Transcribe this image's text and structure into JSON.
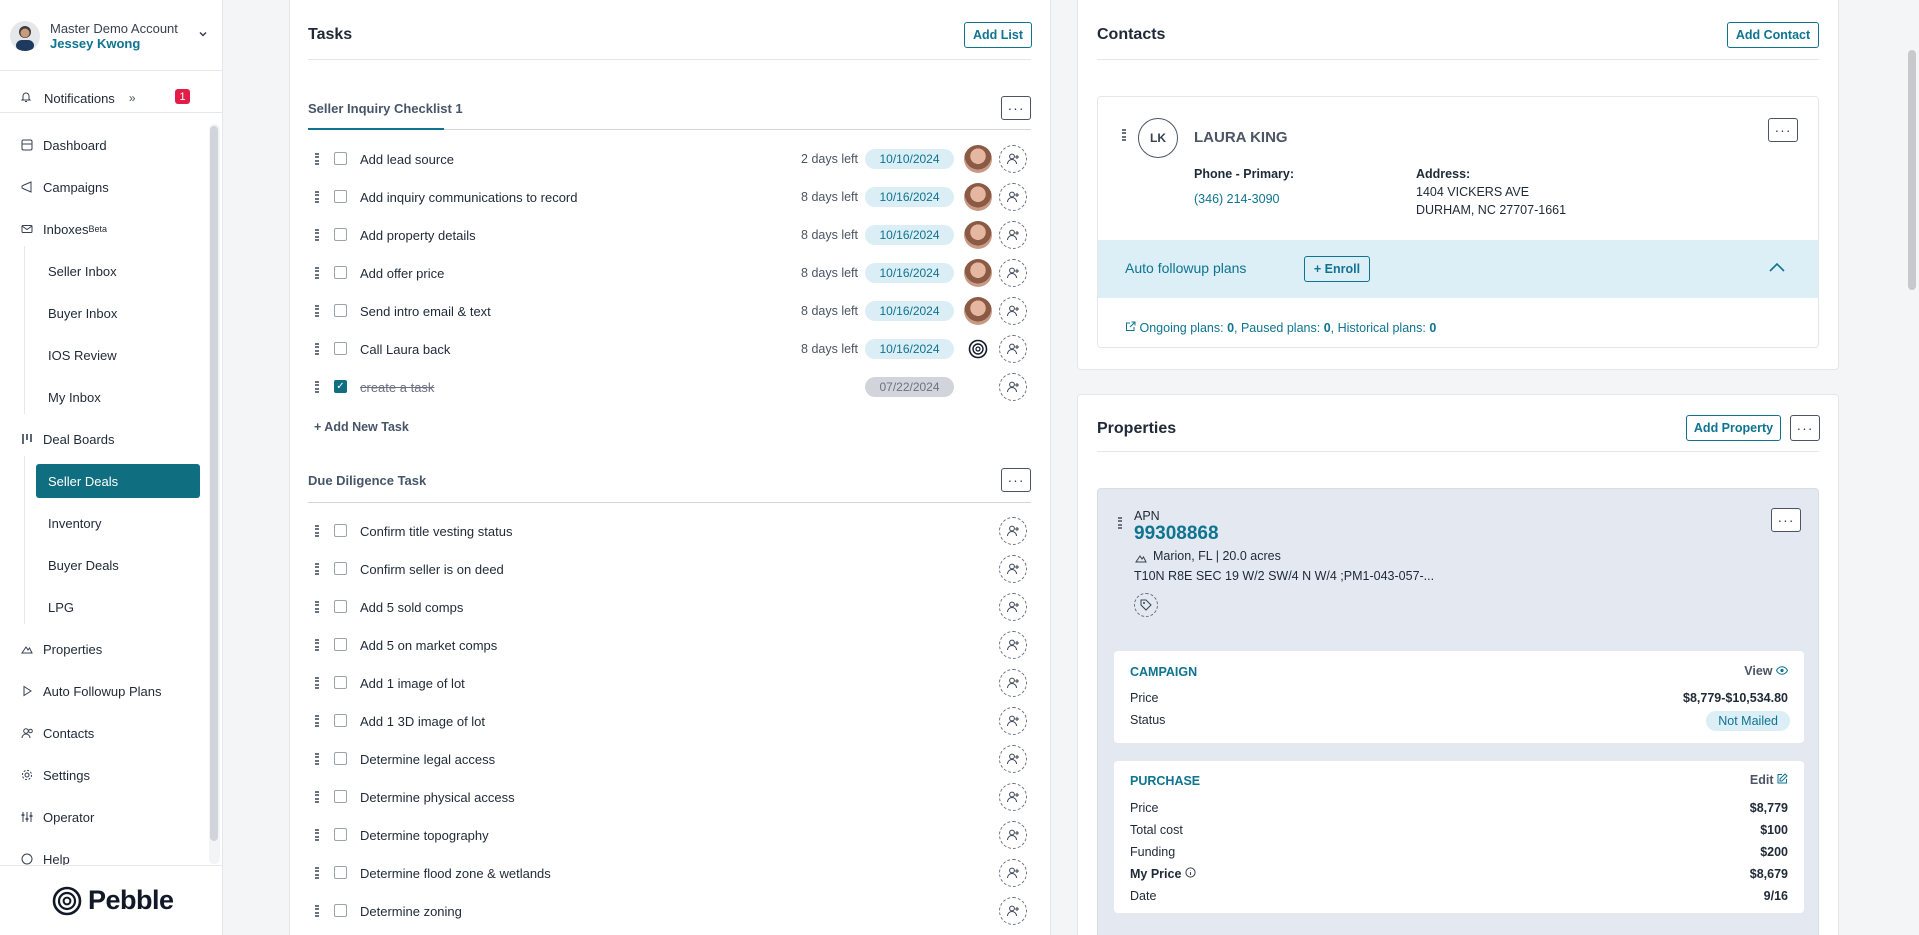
{
  "account": {
    "line1": "Master Demo Account",
    "user": "Jessey Kwong"
  },
  "notifications": {
    "label": "Notifications",
    "expand_glyph": "»",
    "count": "1"
  },
  "nav": {
    "dashboard": "Dashboard",
    "campaigns": "Campaigns",
    "inboxes": "Inboxes",
    "inboxes_badge": "Beta",
    "seller_inbox": "Seller Inbox",
    "buyer_inbox": "Buyer Inbox",
    "ios_review": "IOS Review",
    "my_inbox": "My Inbox",
    "deal_boards": "Deal Boards",
    "seller_deals": "Seller Deals",
    "inventory": "Inventory",
    "buyer_deals": "Buyer Deals",
    "lpg": "LPG",
    "properties": "Properties",
    "auto_followup": "Auto Followup Plans",
    "contacts": "Contacts",
    "settings": "Settings",
    "operator": "Operator",
    "help": "Help"
  },
  "brand": {
    "name": "Pebble"
  },
  "tasks": {
    "title": "Tasks",
    "add_list": "Add List",
    "list1": {
      "name": "Seller Inquiry Checklist 1",
      "items": [
        {
          "name": "Add lead source",
          "days": "2 days left",
          "date": "10/10/2024"
        },
        {
          "name": "Add inquiry communications to record",
          "days": "8 days left",
          "date": "10/16/2024"
        },
        {
          "name": "Add property details",
          "days": "8 days left",
          "date": "10/16/2024"
        },
        {
          "name": "Add offer price",
          "days": "8 days left",
          "date": "10/16/2024"
        },
        {
          "name": "Send intro email & text",
          "days": "8 days left",
          "date": "10/16/2024"
        },
        {
          "name": "Call Laura back",
          "days": "8 days left",
          "date": "10/16/2024"
        },
        {
          "name": "create a task",
          "days": "",
          "date": "07/22/2024"
        }
      ],
      "add_new_task": "+ Add New Task"
    },
    "list2": {
      "name": "Due Diligence Task",
      "items": [
        {
          "name": "Confirm title vesting status"
        },
        {
          "name": "Confirm seller is on deed"
        },
        {
          "name": "Add 5 sold comps"
        },
        {
          "name": "Add 5 on market comps"
        },
        {
          "name": "Add 1 image of lot"
        },
        {
          "name": "Add 1 3D image of lot"
        },
        {
          "name": "Determine legal access"
        },
        {
          "name": "Determine physical access"
        },
        {
          "name": "Determine topography"
        },
        {
          "name": "Determine flood zone & wetlands"
        },
        {
          "name": "Determine zoning"
        }
      ]
    }
  },
  "contacts": {
    "title": "Contacts",
    "add": "Add Contact",
    "card": {
      "initials": "LK",
      "name": "LAURA KING",
      "phone_label": "Phone - Primary:",
      "phone": "(346) 214-3090",
      "address_label": "Address:",
      "address1": "1404 VICKERS AVE",
      "address2": "DURHAM, NC 27707-1661",
      "followup_title": "Auto followup plans",
      "enroll": "+ Enroll",
      "ongoing_label": "Ongoing plans:",
      "ongoing": "0",
      "paused_label": "Paused plans:",
      "paused": "0",
      "historical_label": "Historical plans:",
      "historical": "0"
    }
  },
  "properties": {
    "title": "Properties",
    "add": "Add Property",
    "card": {
      "apn_label": "APN",
      "apn": "99308868",
      "location": "Marion, FL | 20.0 acres",
      "legal": "T10N R8E SEC 19 W/2 SW/4 N W/4 ;PM1-043-057-...",
      "campaign": {
        "title": "CAMPAIGN",
        "action": "View",
        "price_label": "Price",
        "price": "$8,779-$10,534.80",
        "status_label": "Status",
        "status": "Not Mailed"
      },
      "purchase": {
        "title": "PURCHASE",
        "action": "Edit",
        "rows": [
          {
            "label": "Price",
            "value": "$8,779"
          },
          {
            "label": "Total cost",
            "value": "$100"
          },
          {
            "label": "Funding",
            "value": "$200"
          },
          {
            "label": "My Price",
            "value": "$8,679"
          },
          {
            "label": "Date",
            "value": "9/16"
          }
        ]
      }
    }
  }
}
